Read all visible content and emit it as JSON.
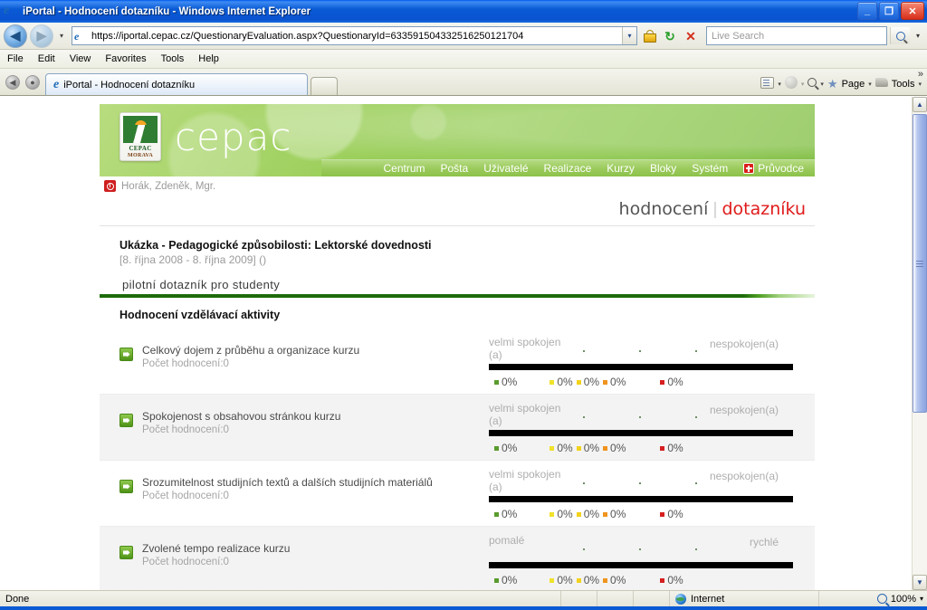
{
  "window": {
    "title": "iPortal - Hodnocení dotazníku - Windows Internet Explorer",
    "minimize_label": "_",
    "restore_label": "❐",
    "close_label": "✕"
  },
  "browser": {
    "back_label": "◀",
    "forward_label": "▶",
    "history_caret": "▾",
    "url": "https://iportal.cepac.cz/QuestionaryEvaluation.aspx?QuestionaryId=633591504332516250121704",
    "url_dropdown_caret": "▾",
    "lock_icon": "lock-icon",
    "refresh_label": "↻",
    "stop_label": "✕",
    "search_placeholder": "Live Search",
    "search_go_icon": "magnifier-icon",
    "search_caret": "▾",
    "menu": [
      "File",
      "Edit",
      "View",
      "Favorites",
      "Tools",
      "Help"
    ],
    "tab_back_label": "◀",
    "tab_recent_label": "●",
    "tab_title": "iPortal - Hodnocení dotazníku",
    "toolbar": {
      "feed_caret": "▾",
      "print_caret": "▾",
      "search_caret": "▾",
      "page_label": "Page",
      "page_caret": "▾",
      "tools_label": "Tools",
      "tools_caret": "▾",
      "overflow_label": "»"
    }
  },
  "statusbar": {
    "status": "Done",
    "zone": "Internet",
    "zoom": "100%",
    "zoom_caret": "▾"
  },
  "site": {
    "logo_word": "cepac",
    "logo_badge_line1": "CEPAC",
    "logo_badge_line2": "MORAVA",
    "nav": [
      {
        "label": "Centrum"
      },
      {
        "label": "Pošta"
      },
      {
        "label": "Uživatelé"
      },
      {
        "label": "Realizace"
      },
      {
        "label": "Kurzy"
      },
      {
        "label": "Bloky"
      },
      {
        "label": "Systém"
      }
    ],
    "nav_guide": "Průvodce",
    "user": "Horák, Zdeněk, Mgr."
  },
  "breadcrumb": {
    "primary": "hodnocení",
    "separator": "|",
    "secondary": "dotazníku"
  },
  "activity": {
    "title": "Ukázka - Pedagogické způsobilosti:  Lektorské dovednosti",
    "period": "[8. října 2008 - 8. října 2009] ()"
  },
  "questionnaire": {
    "name": "pilotní dotazník pro studenty",
    "section_title": "Hodnocení vzdělávací aktivity"
  },
  "scale_colors": [
    "#5a9b2e",
    "#f0e22a",
    "#f2d21c",
    "#f0941e",
    "#d61f1f"
  ],
  "questions": [
    {
      "text": "Celkový dojem z průběhu a organizace kurzu",
      "count_label": "Počet hodnocení:0",
      "left_label": "velmi spokojen (a)",
      "right_label": "nespokojen(a)",
      "values": [
        "0%",
        "0%",
        "0%",
        "0%",
        "0%"
      ]
    },
    {
      "text": "Spokojenost s obsahovou stránkou kurzu",
      "count_label": "Počet hodnocení:0",
      "left_label": "velmi spokojen (a)",
      "right_label": "nespokojen(a)",
      "values": [
        "0%",
        "0%",
        "0%",
        "0%",
        "0%"
      ]
    },
    {
      "text": "Srozumitelnost studijních textů a dalších studijních materiálů",
      "count_label": "Počet hodnocení:0",
      "left_label": "velmi spokojen (a)",
      "right_label": "nespokojen(a)",
      "values": [
        "0%",
        "0%",
        "0%",
        "0%",
        "0%"
      ]
    },
    {
      "text": "Zvolené tempo realizace kurzu",
      "count_label": "Počet hodnocení:0",
      "left_label": "pomalé",
      "right_label": "rychlé",
      "values": [
        "0%",
        "0%",
        "0%",
        "0%",
        "0%"
      ]
    }
  ]
}
